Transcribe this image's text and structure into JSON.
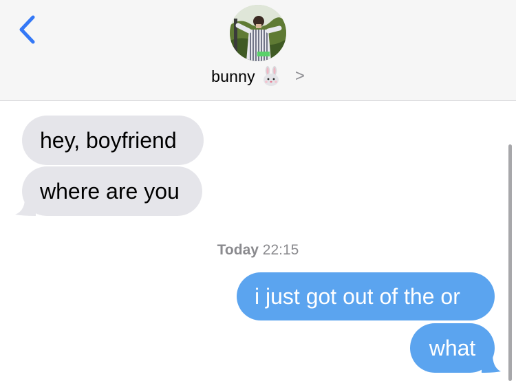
{
  "header": {
    "contact_name": "bunny",
    "contact_emoji": "rabbit-face-emoji",
    "back_icon": "chevron-left-icon",
    "details_icon": "chevron-right-icon",
    "chevron_glyph": ">"
  },
  "messages": [
    {
      "direction": "incoming",
      "text": "hey, boyfriend"
    },
    {
      "direction": "incoming",
      "text": "where are you"
    },
    {
      "direction": "outgoing",
      "text": "i just got out of the or"
    },
    {
      "direction": "outgoing",
      "text": "what"
    }
  ],
  "timestamp": {
    "day": "Today",
    "time": "22:15"
  },
  "colors": {
    "accent": "#3478f6",
    "incoming_bubble": "#e5e5ea",
    "outgoing_bubble": "#5ba4ef",
    "header_bg": "#f6f6f6"
  }
}
